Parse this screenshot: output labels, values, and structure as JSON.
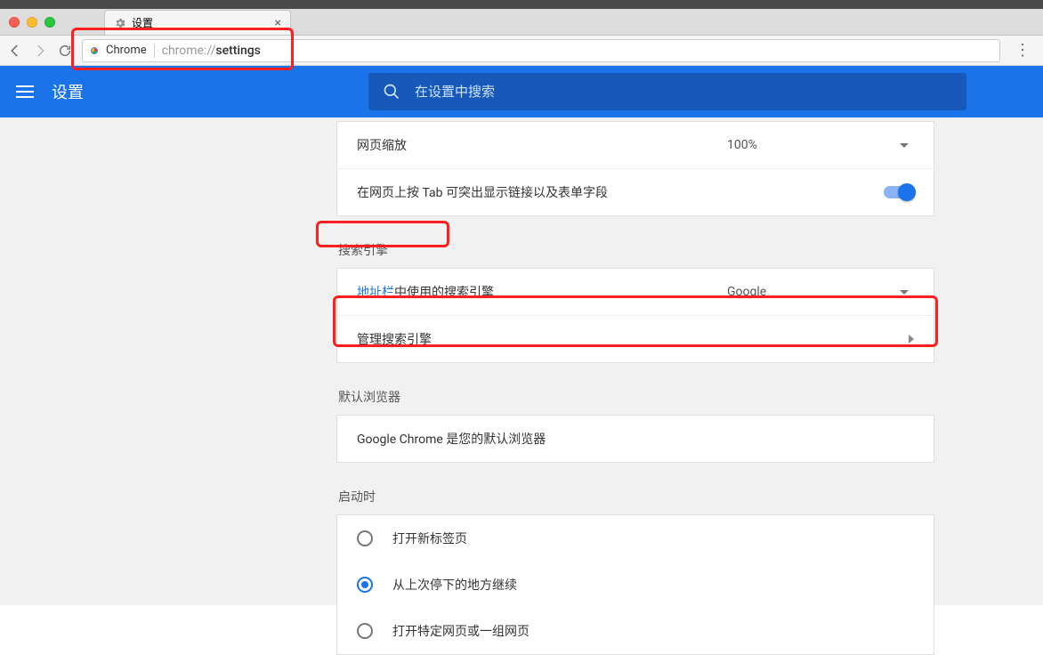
{
  "window": {
    "tab_title": "设置",
    "url_label": "Chrome",
    "url_prefix": "chrome://",
    "url_path": "settings"
  },
  "header": {
    "title": "设置",
    "search_placeholder": "在设置中搜索"
  },
  "page_zoom": {
    "label": "网页缩放",
    "value": "100%"
  },
  "tab_highlight": {
    "label": "在网页上按 Tab 可突出显示链接以及表单字段"
  },
  "search_engine": {
    "section": "搜索引擎",
    "address_bar_link": "地址栏",
    "address_bar_suffix": "中使用的搜索引擎",
    "selected": "Google",
    "manage": "管理搜索引擎"
  },
  "default_browser": {
    "section": "默认浏览器",
    "status": "Google Chrome 是您的默认浏览器"
  },
  "startup": {
    "section": "启动时",
    "options": [
      "打开新标签页",
      "从上次停下的地方继续",
      "打开特定网页或一组网页"
    ],
    "selected_index": 1
  }
}
